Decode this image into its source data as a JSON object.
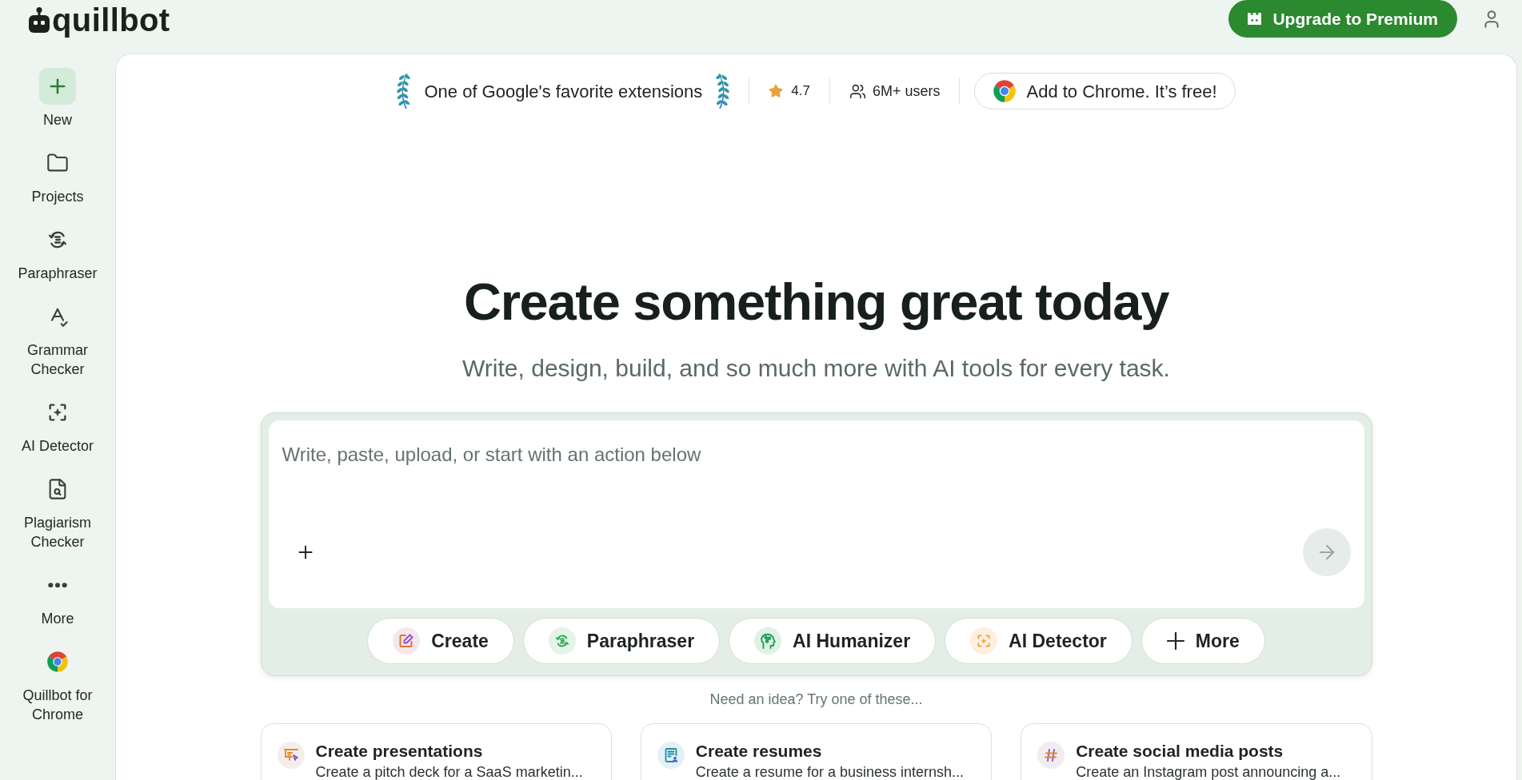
{
  "header": {
    "logo_text": "quillbot",
    "upgrade_button": "Upgrade to Premium"
  },
  "sidebar": {
    "items": [
      {
        "label": "New",
        "selected": true
      },
      {
        "label": "Projects",
        "selected": false
      },
      {
        "label": "Paraphraser",
        "selected": false
      },
      {
        "label": "Grammar Checker",
        "selected": false
      },
      {
        "label": "AI Detector",
        "selected": false
      },
      {
        "label": "Plagiarism Checker",
        "selected": false
      },
      {
        "label": "More",
        "selected": false
      },
      {
        "label": "Quillbot for Chrome",
        "selected": false
      }
    ]
  },
  "promo_bar": {
    "award": "One of Google's favorite extensions",
    "rating": "4.7",
    "users": "6M+ users",
    "chrome_button": "Add to Chrome. It’s free!"
  },
  "hero": {
    "title": "Create something great today",
    "subtitle": "Write, design, build, and so much more with AI tools for every task."
  },
  "composer": {
    "placeholder": "Write, paste, upload, or start with an action below",
    "actions": [
      "Create",
      "Paraphraser",
      "AI Humanizer",
      "AI Detector",
      "More"
    ]
  },
  "suggestions": {
    "prompt": "Need an idea? Try one of these...",
    "cards": [
      {
        "title": "Create presentations",
        "description": "Create a pitch deck for a SaaS marketin..."
      },
      {
        "title": "Create resumes",
        "description": "Create a resume for a business internsh..."
      },
      {
        "title": "Create social media posts",
        "description": "Create an Instagram post announcing a..."
      }
    ]
  }
}
